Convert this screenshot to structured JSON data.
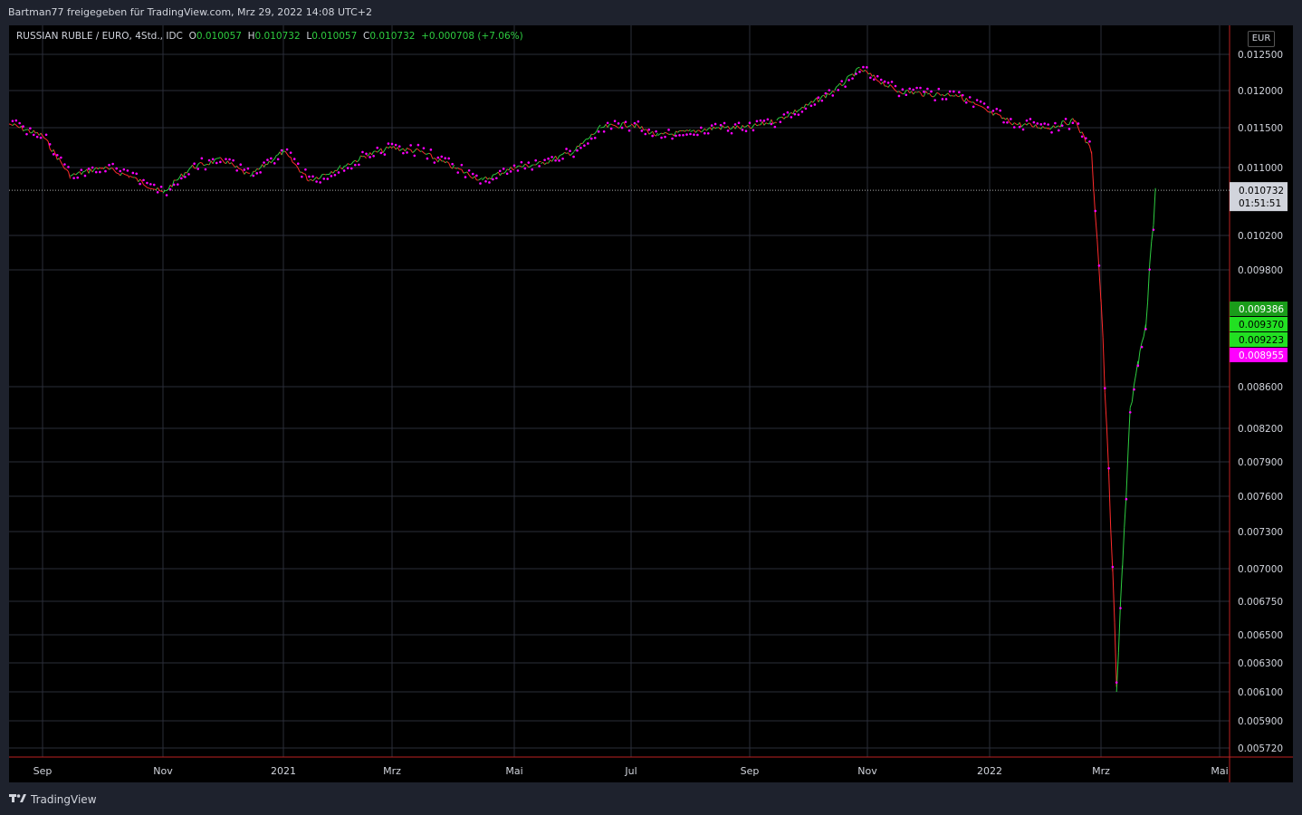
{
  "header": {
    "publisher": "Bartman77 freigegeben für TradingView.com, Mrz 29, 2022 14:08 UTC+2"
  },
  "legend": {
    "symbol": "RUSSIAN RUBLE / EURO, 4Std., IDC",
    "o_label": "O",
    "o_value": "0.010057",
    "h_label": "H",
    "h_value": "0.010732",
    "l_label": "L",
    "l_value": "0.010057",
    "c_label": "C",
    "c_value": "0.010732",
    "change": "+0.000708 (+7.06%)"
  },
  "currency_button": "EUR",
  "brand": {
    "name": "TradingView"
  },
  "colors": {
    "background": "#000000",
    "up": "#2ecc40",
    "down": "#ff2b2b",
    "sar": "#ff00ff",
    "grid": "#2a2e39"
  },
  "chart_data": {
    "type": "line",
    "title": "RUSSIAN RUBLE / EURO, 4Std., IDC",
    "y_ticks": [
      "0.012500",
      "0.012000",
      "0.011500",
      "0.011000",
      "0.010200",
      "0.009800",
      "0.008600",
      "0.008200",
      "0.007900",
      "0.007600",
      "0.007300",
      "0.007000",
      "0.006750",
      "0.006500",
      "0.006300",
      "0.006100",
      "0.005900",
      "0.005720"
    ],
    "x_ticks": [
      "Sep",
      "Nov",
      "2021",
      "Mrz",
      "Mai",
      "Jul",
      "Sep",
      "Nov",
      "2022",
      "Mrz",
      "Mai"
    ],
    "ylim": [
      0.00565,
      0.0127
    ],
    "series": [
      {
        "x": [
          "2020-08-18",
          "2020-09-01",
          "2020-09-15",
          "2020-10-01",
          "2020-10-15",
          "2020-11-01",
          "2020-11-15",
          "2020-12-01",
          "2020-12-15",
          "2021-01-01",
          "2021-01-15",
          "2021-02-01",
          "2021-02-15",
          "2021-03-01",
          "2021-03-15",
          "2021-04-01",
          "2021-04-15",
          "2021-05-01",
          "2021-05-15",
          "2021-06-01",
          "2021-06-15",
          "2021-07-01",
          "2021-07-15",
          "2021-08-01",
          "2021-08-15",
          "2021-09-01",
          "2021-09-15",
          "2021-10-01",
          "2021-10-15",
          "2021-10-28",
          "2021-11-15",
          "2021-12-01",
          "2021-12-15",
          "2022-01-01",
          "2022-01-15",
          "2022-02-01",
          "2022-02-15",
          "2022-02-24",
          "2022-03-01",
          "2022-03-07",
          "2022-03-09",
          "2022-03-12",
          "2022-03-16",
          "2022-03-20",
          "2022-03-24",
          "2022-03-29"
        ],
        "values": [
          0.01155,
          0.0114,
          0.0109,
          0.011,
          0.0109,
          0.0107,
          0.011,
          0.0111,
          0.0109,
          0.0112,
          0.01085,
          0.011,
          0.01115,
          0.01125,
          0.0112,
          0.011,
          0.01085,
          0.011,
          0.01105,
          0.0112,
          0.0115,
          0.01155,
          0.0114,
          0.01145,
          0.0115,
          0.0115,
          0.0116,
          0.0118,
          0.012,
          0.0123,
          0.012,
          0.01195,
          0.01195,
          0.0117,
          0.01155,
          0.0115,
          0.0116,
          0.0112,
          0.0095,
          0.007,
          0.0061,
          0.007,
          0.0084,
          0.0088,
          0.0092,
          0.01073
        ]
      }
    ],
    "price_labels": {
      "last": "0.010732",
      "countdown": "01:51:51",
      "level1": "0.009386",
      "level2": "0.009370",
      "level3": "0.009223",
      "level4": "0.008955"
    }
  }
}
